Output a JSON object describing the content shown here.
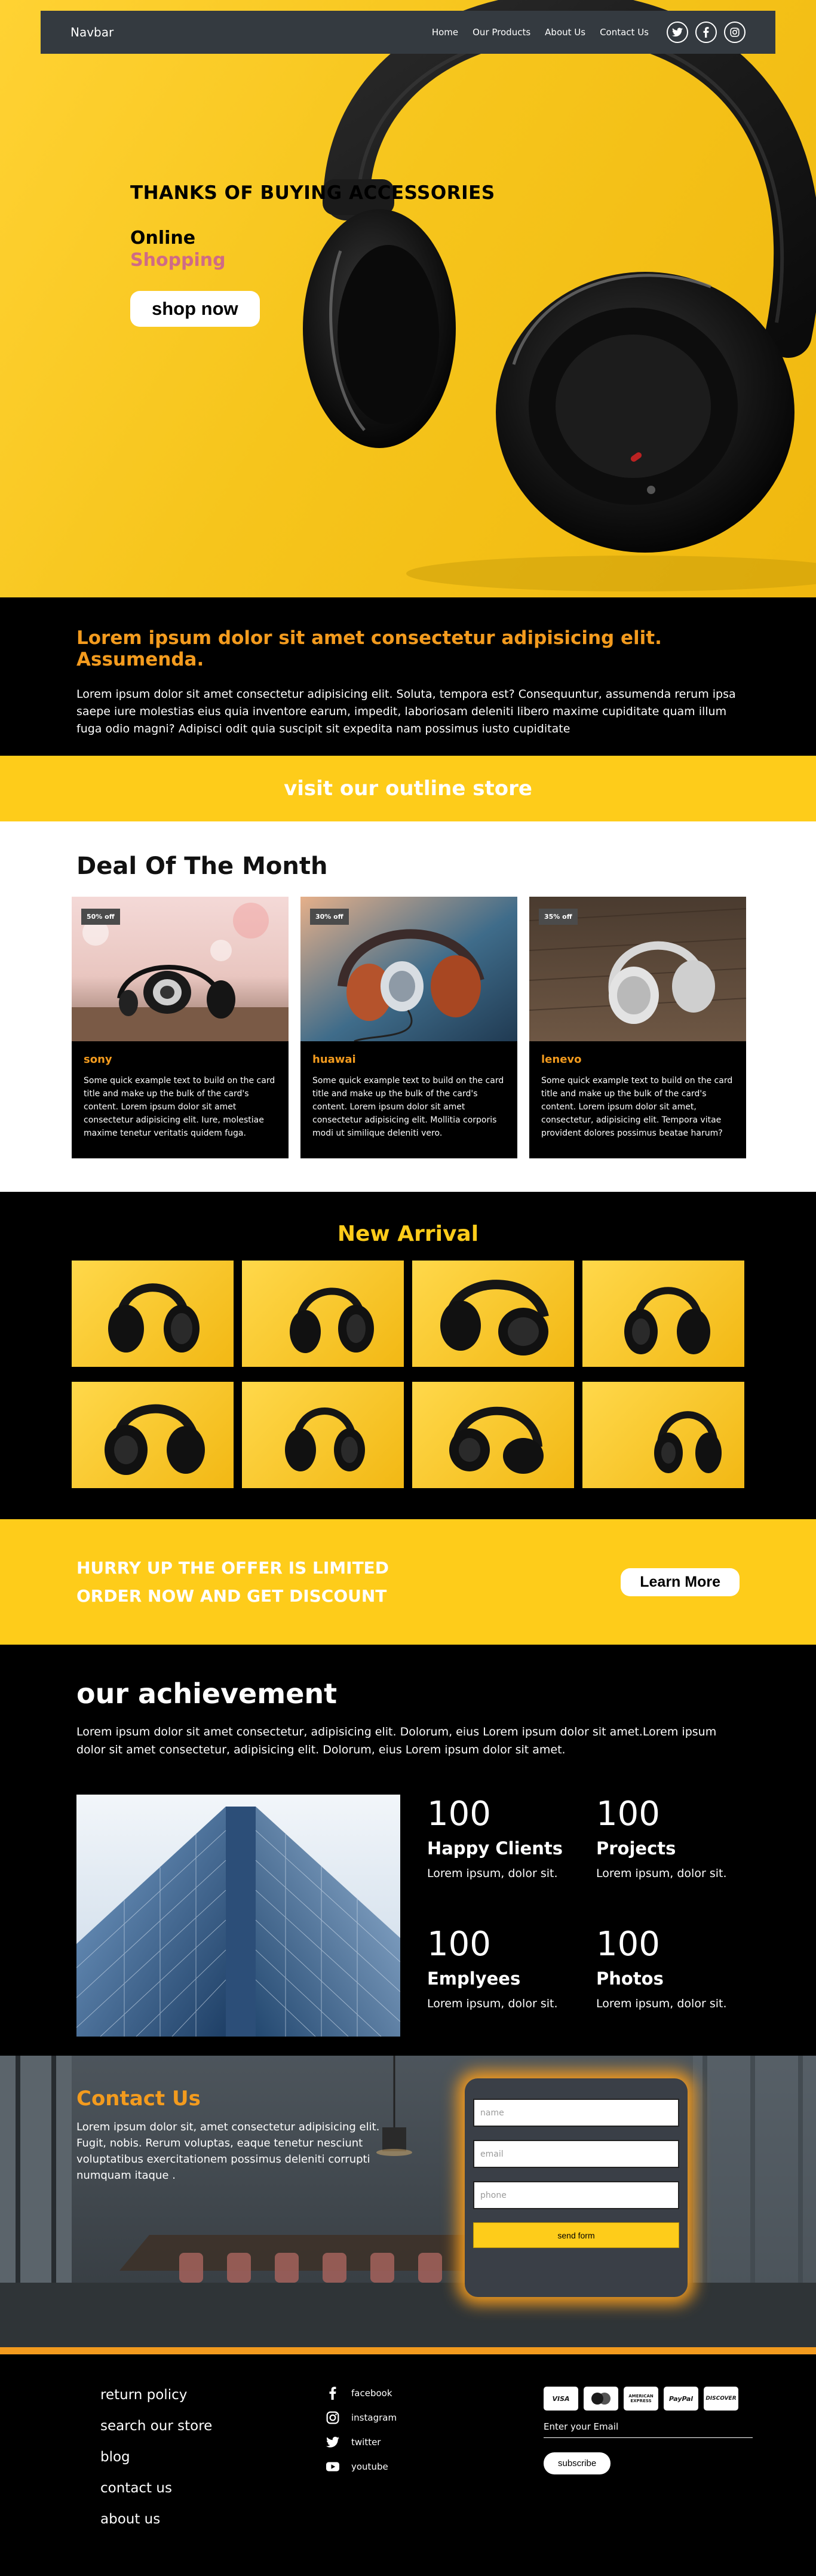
{
  "navbar": {
    "brand": "Navbar",
    "links": [
      "Home",
      "Our Products",
      "About Us",
      "Contact Us"
    ],
    "social_icons": [
      "twitter-icon",
      "facebook-icon",
      "instagram-icon"
    ]
  },
  "hero": {
    "title": "THANKS OF BUYING ACCESSORIES",
    "online": "Online",
    "shopping": "Shopping",
    "button": "shop now"
  },
  "intro": {
    "heading": "Lorem ipsum dolor sit amet consectetur adipisicing elit. Assumenda.",
    "body": "Lorem ipsum dolor sit amet consectetur adipisicing elit. Soluta, tempora est? Consequuntur, assumenda rerum ipsa saepe iure molestias eius quia inventore earum, impedit, laboriosam deleniti libero maxime cupiditate quam illum fuga odio magni? Adipisci odit quia suscipit sit expedita nam possimus iusto cupiditate"
  },
  "visit_banner": "visit our outline store",
  "deals": {
    "title": "Deal Of The Month",
    "cards": [
      {
        "badge": "50% off",
        "name": "sony",
        "text": "Some quick example text to build on the card title and make up the bulk of the card's content. Lorem ipsum dolor sit amet consectetur adipisicing elit. Iure, molestiae maxime tenetur veritatis quidem fuga."
      },
      {
        "badge": "30% off",
        "name": "huawai",
        "text": "Some quick example text to build on the card title and make up the bulk of the card's content. Lorem ipsum dolor sit amet consectetur adipisicing elit. Mollitia corporis modi ut similique deleniti vero."
      },
      {
        "badge": "35% off",
        "name": "lenevo",
        "text": "Some quick example text to build on the card title and make up the bulk of the card's content. Lorem ipsum dolor sit amet, consectetur, adipisicing elit. Tempora vitae provident dolores possimus beatae harum?"
      }
    ]
  },
  "arrival": {
    "title": "New Arrival"
  },
  "offer": {
    "line1": "HURRY UP THE OFFER IS LIMITED",
    "line2": "ORDER NOW AND GET DISCOUNT",
    "button": "Learn More"
  },
  "achievement": {
    "title": "our achievement",
    "body": "Lorem ipsum dolor sit amet consectetur, adipisicing elit. Dolorum, eius Lorem ipsum dolor sit amet.Lorem ipsum dolor sit amet consectetur, adipisicing elit. Dolorum, eius Lorem ipsum dolor sit amet.",
    "stats": [
      {
        "number": "100",
        "label": "Happy Clients",
        "sub": "Lorem ipsum, dolor sit."
      },
      {
        "number": "100",
        "label": "Projects",
        "sub": "Lorem ipsum, dolor sit."
      },
      {
        "number": "100",
        "label": "Emplyees",
        "sub": "Lorem ipsum, dolor sit."
      },
      {
        "number": "100",
        "label": "Photos",
        "sub": "Lorem ipsum, dolor sit."
      }
    ]
  },
  "contact": {
    "title": "Contact Us",
    "text": "Lorem ipsum dolor sit, amet consectetur adipisicing elit. Fugit, nobis. Rerum voluptas, eaque tenetur nesciunt voluptatibus exercitationem possimus deleniti corrupti numquam itaque .",
    "name_placeholder": "name",
    "email_placeholder": "email",
    "phone_placeholder": "phone",
    "send_button": "send form"
  },
  "footer": {
    "links": [
      "return policy",
      "search our store",
      "blog",
      "contact us",
      "about us"
    ],
    "social": [
      {
        "icon": "facebook-icon",
        "label": "facebook"
      },
      {
        "icon": "instagram-icon",
        "label": "instagram"
      },
      {
        "icon": "twitter-icon",
        "label": "twitter"
      },
      {
        "icon": "youtube-icon",
        "label": "youtube"
      }
    ],
    "payment_cards": [
      "VISA",
      "mastercard",
      "AMERICAN EXPRESS",
      "PayPal",
      "DISCOVER"
    ],
    "email_label": "Enter your Email",
    "subscribe_button": "subscribe"
  },
  "colors": {
    "accent_yellow": "#fecc1a",
    "accent_orange": "#f39b1e",
    "shopping_pink": "#cf6b86",
    "navbar_bg": "#343a40"
  }
}
